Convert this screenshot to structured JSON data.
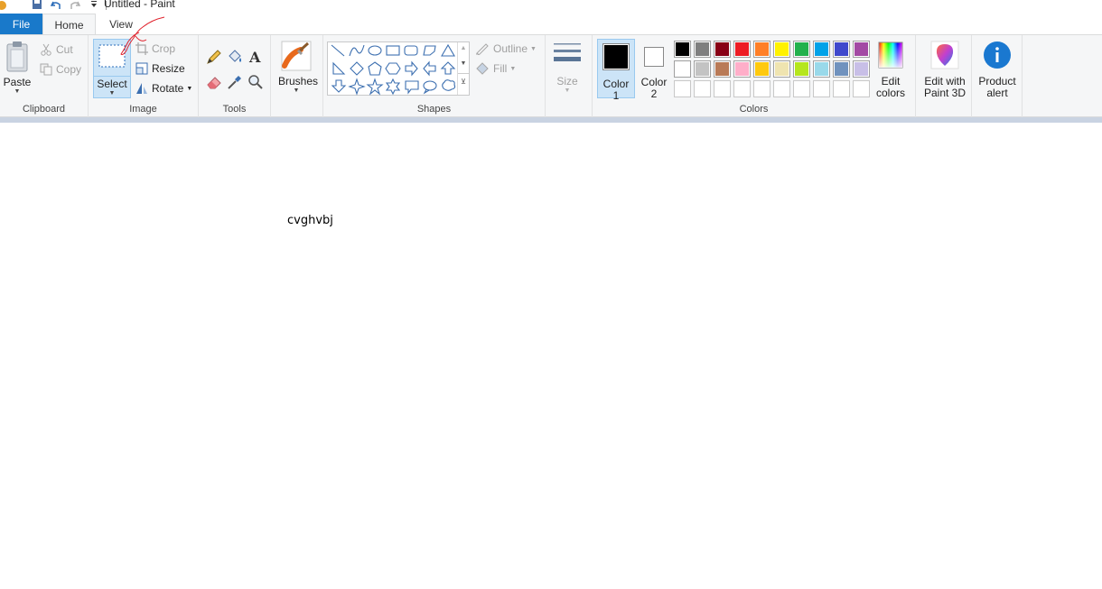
{
  "window": {
    "title": "Untitled - Paint"
  },
  "tabs": [
    {
      "label": "File"
    },
    {
      "label": "Home"
    },
    {
      "label": "View"
    }
  ],
  "clipboard": {
    "paste": "Paste",
    "cut": "Cut",
    "copy": "Copy",
    "group": "Clipboard"
  },
  "image": {
    "select": "Select",
    "crop": "Crop",
    "resize": "Resize",
    "rotate": "Rotate",
    "group": "Image"
  },
  "tools": {
    "group": "Tools"
  },
  "brushes": {
    "label": "Brushes"
  },
  "shapes": {
    "outline": "Outline",
    "fill": "Fill",
    "group": "Shapes"
  },
  "size": {
    "label": "Size"
  },
  "colors": {
    "color1_line1": "Color",
    "color1_line2": "1",
    "color2_line1": "Color",
    "color2_line2": "2",
    "edit_line1": "Edit",
    "edit_line2": "colors",
    "group": "Colors",
    "color1_value": "#000000",
    "color2_value": "#ffffff",
    "palette_row1": [
      "#000000",
      "#7f7f7f",
      "#880015",
      "#ed1c24",
      "#ff7f27",
      "#fff200",
      "#22b14c",
      "#00a2e8",
      "#3f48cc",
      "#a349a4"
    ],
    "palette_row2": [
      "#ffffff",
      "#c3c3c3",
      "#b97a57",
      "#ffaec9",
      "#ffc90e",
      "#efe4b0",
      "#b5e61d",
      "#99d9ea",
      "#7092be",
      "#c8bfe7"
    ]
  },
  "paint3d": {
    "line1": "Edit with",
    "line2": "Paint 3D"
  },
  "product_alert": {
    "line1": "Product",
    "line2": "alert"
  },
  "canvas": {
    "text": "cvghvbj"
  }
}
